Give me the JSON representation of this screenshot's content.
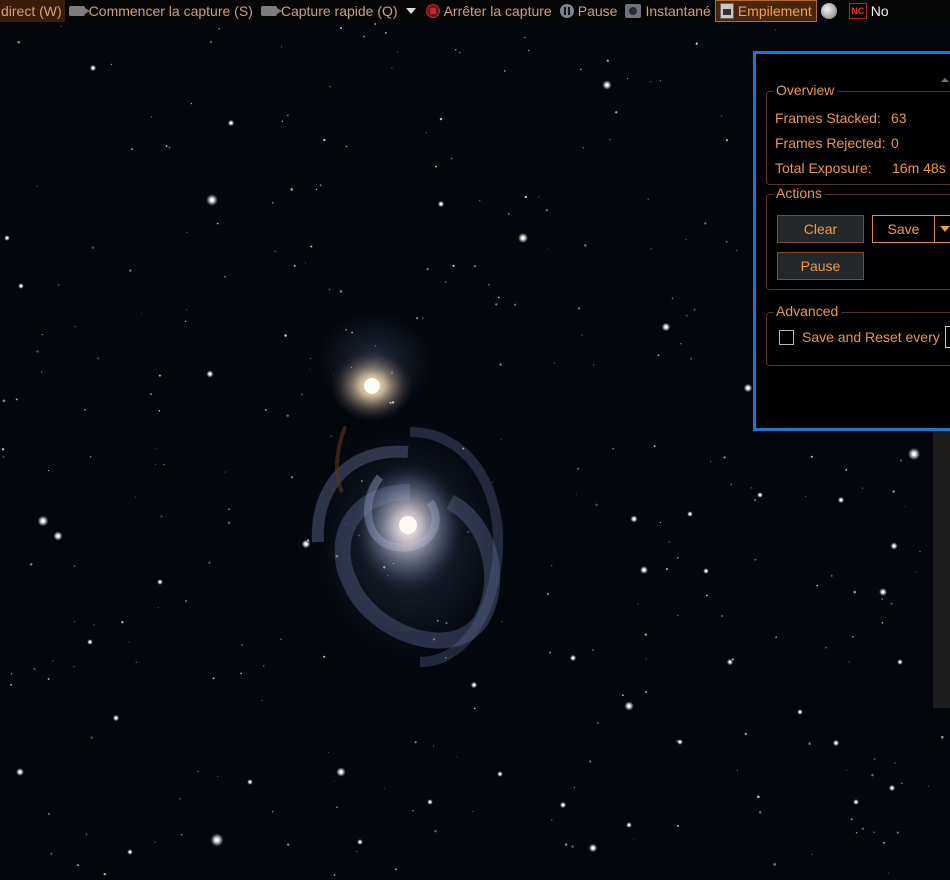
{
  "toolbar": {
    "items": [
      {
        "label": "direct (W)"
      },
      {
        "label": "Commencer la capture (S)",
        "icon": "camera-icon"
      },
      {
        "label": "Capture rapide (Q)",
        "icon": "camera-icon"
      },
      {
        "label": "Arrêter la capture",
        "icon": "stop-icon"
      },
      {
        "label": "Pause",
        "icon": "pause-icon"
      },
      {
        "label": "Instantané",
        "icon": "snapshot-icon"
      },
      {
        "label": "Empilement",
        "icon": "stacking-icon",
        "active": true
      },
      {
        "label": "",
        "icon": "moon-icon"
      },
      {
        "label": "No",
        "icon": "nc-icon"
      }
    ],
    "nc_badge": "NC"
  },
  "panel": {
    "overview": {
      "legend": "Overview",
      "frames_stacked_label": "Frames Stacked:",
      "frames_stacked_value": "63",
      "frames_rejected_label": "Frames Rejected:",
      "frames_rejected_value": "0",
      "total_exposure_label": "Total Exposure:",
      "total_exposure_value": "16m 48s"
    },
    "actions": {
      "legend": "Actions",
      "clear_label": "Clear",
      "save_label": "Save",
      "pause_label": "Pause"
    },
    "advanced": {
      "legend": "Advanced",
      "save_reset_label": "Save and Reset every",
      "save_reset_checked": false
    }
  },
  "colors": {
    "accent_orange": "#f0973c",
    "panel_border_blue": "#1978d4",
    "toolbar_text": "#c9a27a",
    "sky_background": "#03060b"
  }
}
